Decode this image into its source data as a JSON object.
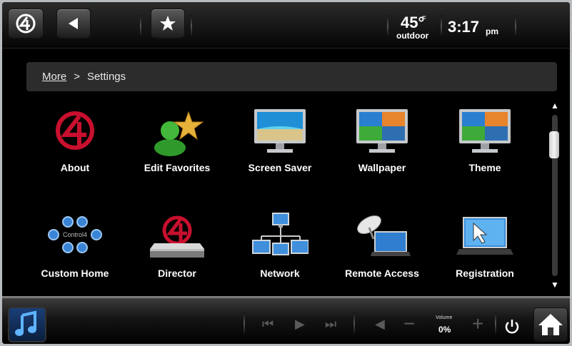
{
  "topbar": {
    "temperature": "45°",
    "temperature_unit": "F",
    "temperature_label": "outdoor",
    "time": "3:17",
    "time_ampm": "pm"
  },
  "breadcrumb": {
    "parent": "More",
    "separator": ">",
    "current": "Settings"
  },
  "tiles": [
    {
      "label": "About",
      "icon": "control4-logo-icon"
    },
    {
      "label": "Edit Favorites",
      "icon": "user-favorite-icon"
    },
    {
      "label": "Screen Saver",
      "icon": "monitor-beach-icon"
    },
    {
      "label": "Wallpaper",
      "icon": "monitor-landscape-icon"
    },
    {
      "label": "Theme",
      "icon": "monitor-landscape-icon"
    },
    {
      "label": "Custom Home",
      "icon": "custom-home-icon",
      "sublabel": "Control4"
    },
    {
      "label": "Director",
      "icon": "director-device-icon"
    },
    {
      "label": "Network",
      "icon": "network-computers-icon"
    },
    {
      "label": "Remote Access",
      "icon": "satellite-laptop-icon"
    },
    {
      "label": "Registration",
      "icon": "laptop-cursor-icon"
    }
  ],
  "bottombar": {
    "volume_label": "Volume",
    "volume_value": "0%"
  },
  "colors": {
    "brand_red": "#c8102e",
    "background": "#000000"
  }
}
